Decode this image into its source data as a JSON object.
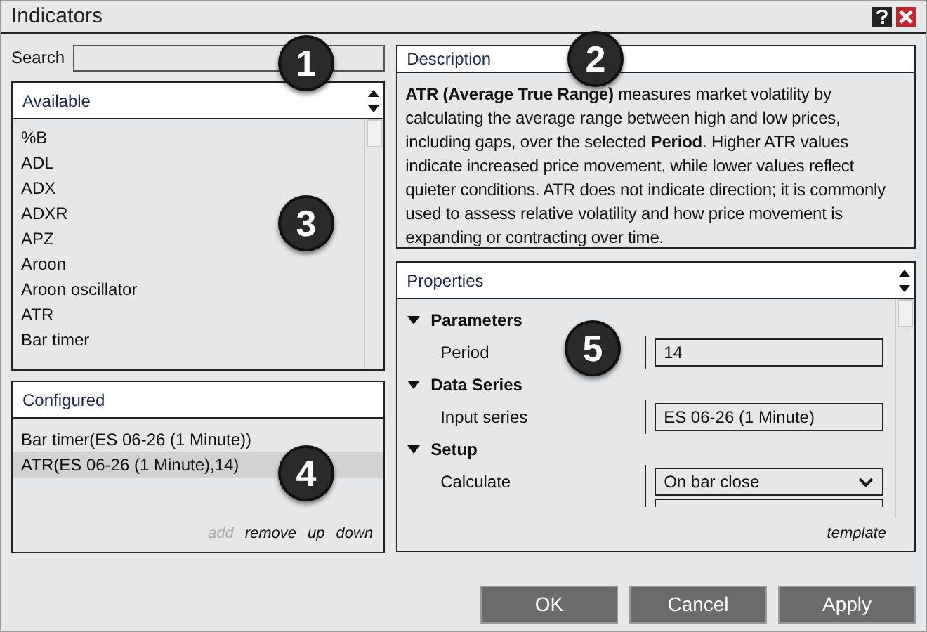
{
  "window": {
    "title": "Indicators"
  },
  "search": {
    "label": "Search"
  },
  "available": {
    "title": "Available",
    "items": [
      {
        "label": "%B"
      },
      {
        "label": "ADL"
      },
      {
        "label": "ADX"
      },
      {
        "label": "ADXR"
      },
      {
        "label": "APZ"
      },
      {
        "label": "Aroon"
      },
      {
        "label": "Aroon oscillator"
      },
      {
        "label": "ATR"
      },
      {
        "label": "Bar timer"
      }
    ]
  },
  "configured": {
    "title": "Configured",
    "items": [
      {
        "label": "Bar timer(ES 06-26 (1 Minute))",
        "selected": false
      },
      {
        "label": "ATR(ES 06-26 (1 Minute),14)",
        "selected": true
      }
    ],
    "actions": [
      {
        "label": "add",
        "disabled": true
      },
      {
        "label": "remove",
        "disabled": false
      },
      {
        "label": "up",
        "disabled": false
      },
      {
        "label": "down",
        "disabled": false
      }
    ]
  },
  "description": {
    "title": "Description",
    "text": "**ATR (Average True Range)** measures market volatility by calculating the average range between high and low prices, including gaps, over the selected **Period**. Higher ATR values indicate increased price movement, while lower values reflect quieter conditions. ATR does not indicate direction; it is commonly used to assess relative volatility and how price movement is expanding or contracting over time."
  },
  "properties": {
    "title": "Properties",
    "groups": [
      {
        "label": "Parameters",
        "expanded": true,
        "children": [
          {
            "label": "Period",
            "kind": "text",
            "value": "14"
          }
        ]
      },
      {
        "label": "Data Series",
        "expanded": true,
        "children": [
          {
            "label": "Input series",
            "kind": "text",
            "value": "ES 06-26 (1 Minute)"
          }
        ]
      },
      {
        "label": "Setup",
        "expanded": true,
        "children": [
          {
            "label": "Calculate",
            "kind": "dropdown",
            "value": "On bar close"
          }
        ]
      }
    ],
    "template": "template"
  },
  "buttons": [
    {
      "label": "OK"
    },
    {
      "label": "Cancel"
    },
    {
      "label": "Apply"
    }
  ],
  "callouts": [
    {
      "label": "1"
    },
    {
      "label": "2"
    },
    {
      "label": "3"
    },
    {
      "label": "5"
    },
    {
      "label": "4"
    }
  ]
}
